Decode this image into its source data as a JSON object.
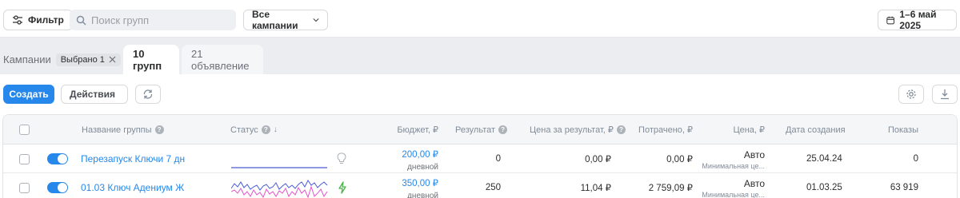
{
  "toolbar": {
    "filter_label": "Фильтр",
    "search_placeholder": "Поиск групп",
    "campaigns_select": "Все кампании",
    "date_range": "1–6 май 2025"
  },
  "tabs": {
    "campaigns_label": "Кампании",
    "selected_chip": "Выбрано 1",
    "groups_tab": "10 групп",
    "ads_tab": "21 объявление"
  },
  "actions": {
    "create_label": "Создать",
    "actions_label": "Действия"
  },
  "table": {
    "headers": {
      "name": "Название группы",
      "status": "Статус",
      "budget": "Бюджет, ₽",
      "result": "Результат",
      "cost_per_result": "Цена за результат, ₽",
      "spent": "Потрачено, ₽",
      "price": "Цена, ₽",
      "created": "Дата создания",
      "impressions": "Показы"
    },
    "rows": [
      {
        "name": "Перезапуск Ключи 7 дн",
        "budget": "200,00 ₽",
        "budget_period": "дневной",
        "result": "0",
        "cost_per_result": "0,00 ₽",
        "spent": "0,00 ₽",
        "price": "Авто",
        "price_sub": "Минимальная це...",
        "created": "25.04.24",
        "impressions": "0"
      },
      {
        "name": "01.03 Ключ Адениум Ж",
        "budget": "350,00 ₽",
        "budget_period": "дневной",
        "result": "250",
        "cost_per_result": "11,04 ₽",
        "spent": "2 759,09 ₽",
        "price": "Авто",
        "price_sub": "Минимальная це...",
        "created": "01.03.25",
        "impressions": "63 919"
      }
    ]
  },
  "colors": {
    "accent": "#2688eb",
    "sparkline_primary": "#4a5bd4",
    "sparkline_secondary": "#e255c8",
    "status_active": "#4bb34b"
  }
}
